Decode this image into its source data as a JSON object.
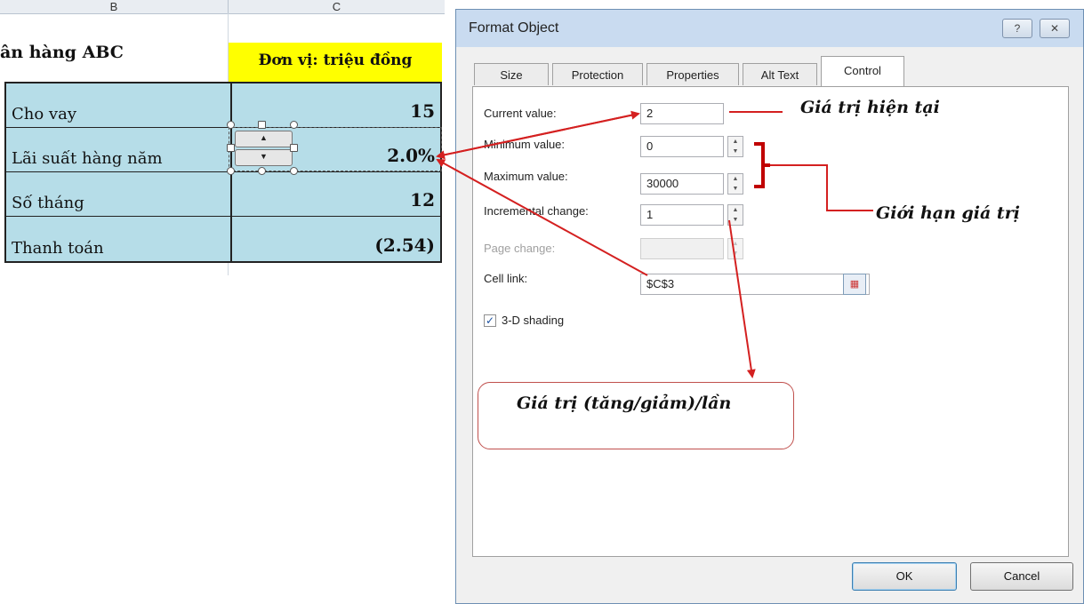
{
  "sheet": {
    "col_b": "B",
    "col_c": "C",
    "title_partial": "ân hàng ABC",
    "unit": "Đơn vị: triệu đồng",
    "rows": [
      {
        "label": "Cho vay",
        "value": "15"
      },
      {
        "label": "Lãi suất hàng năm",
        "value": "2.0%"
      },
      {
        "label": "Số tháng",
        "value": "12"
      },
      {
        "label": "Thanh toán",
        "value": "(2.54)"
      }
    ],
    "spin_up": "▲",
    "spin_down": "▼"
  },
  "dialog": {
    "title": "Format Object",
    "help_btn": "?",
    "close_btn": "✕",
    "tabs": [
      "Size",
      "Protection",
      "Properties",
      "Alt Text",
      "Control"
    ],
    "active_tab": "Control",
    "fields": {
      "current_value": {
        "label": "Current value:",
        "value": "2"
      },
      "minimum_value": {
        "label": "Minimum value:",
        "value": "0"
      },
      "maximum_value": {
        "label": "Maximum value:",
        "value": "30000"
      },
      "incremental_change": {
        "label": "Incremental change:",
        "value": "1"
      },
      "page_change": {
        "label": "Page change:",
        "value": ""
      },
      "cell_link": {
        "label": "Cell link:",
        "value": "$C$3"
      }
    },
    "shading": {
      "label": "3-D shading",
      "checked": true,
      "mark": "✓"
    },
    "ok": "OK",
    "cancel": "Cancel"
  },
  "annotations": {
    "current": "Giá trị hiện tại",
    "limits": "Giới hạn giá trị",
    "step": "Giá trị (tăng/giảm)/lần"
  },
  "colors": {
    "table_fill": "#b6dde8",
    "unit_fill": "#ffff00",
    "arrow": "#d42020",
    "title_bar": "#c9dbf0"
  }
}
